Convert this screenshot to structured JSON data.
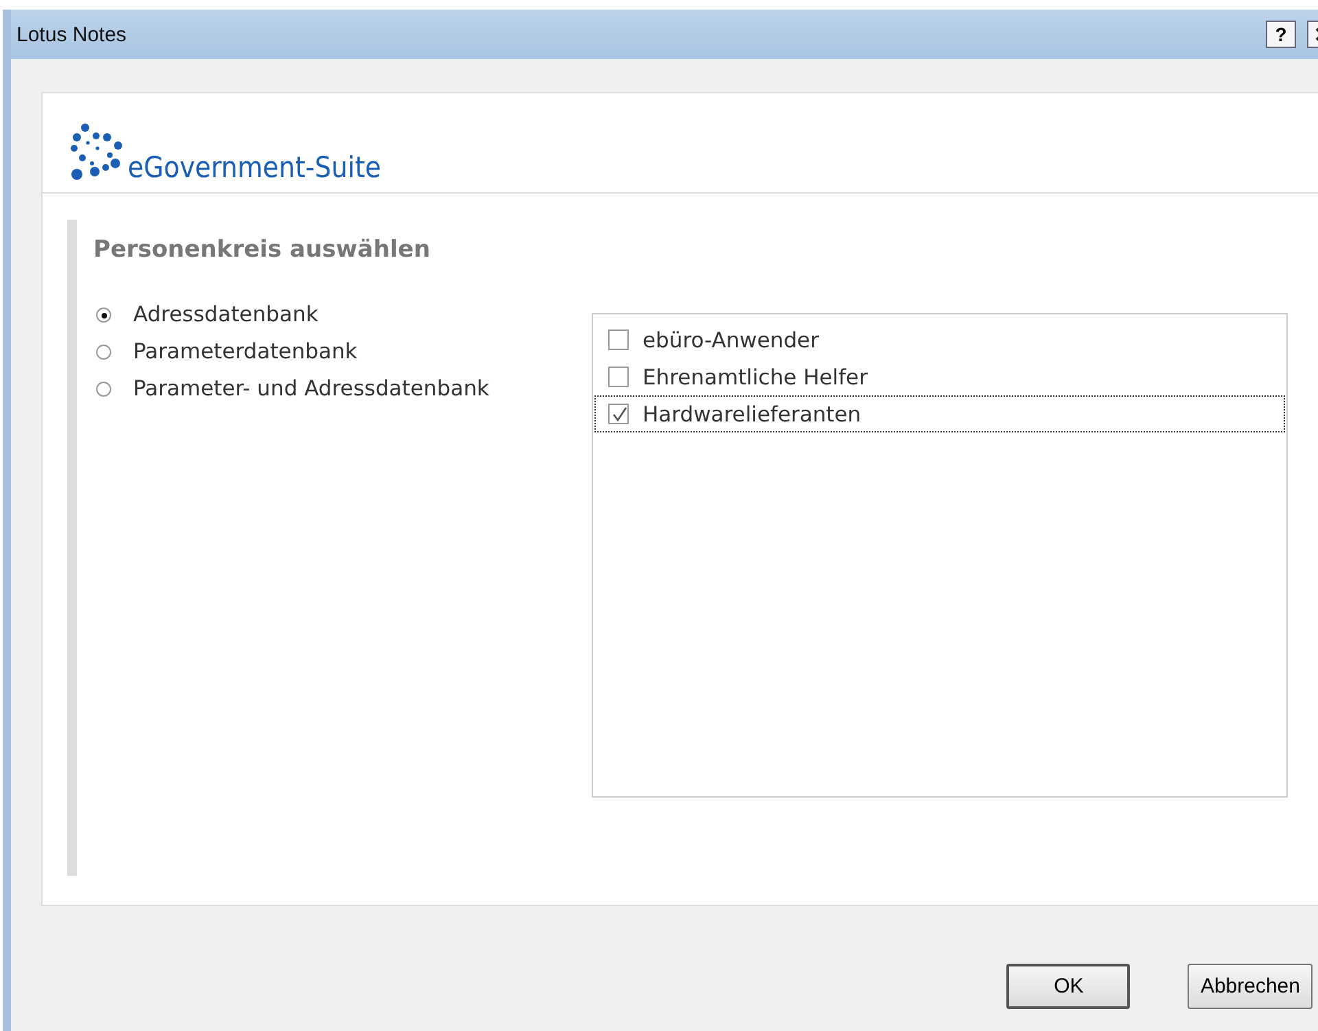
{
  "window": {
    "title": "Lotus Notes",
    "help_button": "?"
  },
  "header": {
    "product_name": "eGovernment-Suite"
  },
  "section": {
    "heading": "Personenkreis auswählen"
  },
  "sources": [
    {
      "label": "Adressdatenbank",
      "selected": true
    },
    {
      "label": "Parameterdatenbank",
      "selected": false
    },
    {
      "label": "Parameter- und Adressdatenbank",
      "selected": false
    }
  ],
  "groups": [
    {
      "label": "ebüro-Anwender",
      "checked": false,
      "focused": false
    },
    {
      "label": "Ehrenamtliche Helfer",
      "checked": false,
      "focused": false
    },
    {
      "label": "Hardwarelieferanten",
      "checked": true,
      "focused": true
    }
  ],
  "buttons": [
    {
      "label": "OK",
      "default": true
    },
    {
      "label": "Abbrechen",
      "default": false
    }
  ]
}
